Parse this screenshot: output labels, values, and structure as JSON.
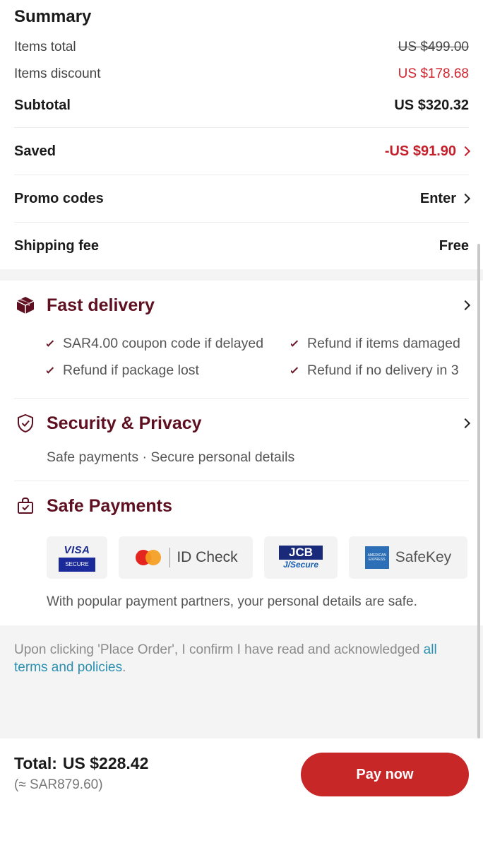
{
  "summary": {
    "title": "Summary",
    "items_total_label": "Items total",
    "items_total_value": "US $499.00",
    "items_discount_label": "Items discount",
    "items_discount_value": "US $178.68",
    "subtotal_label": "Subtotal",
    "subtotal_value": "US $320.32",
    "saved_label": "Saved",
    "saved_value": "-US $91.90",
    "promo_label": "Promo codes",
    "promo_value": "Enter",
    "shipping_label": "Shipping fee",
    "shipping_value": "Free"
  },
  "fast_delivery": {
    "title": "Fast delivery",
    "icon": "package-icon",
    "items": [
      "SAR4.00 coupon code if delayed",
      "Refund if items damaged",
      "Refund if package lost",
      "Refund if no delivery in 3"
    ]
  },
  "security": {
    "title": "Security & Privacy",
    "icon": "shield-check-icon",
    "description": "Safe payments · Secure personal details"
  },
  "safe_payments": {
    "title": "Safe Payments",
    "icon": "bag-check-icon",
    "partners": {
      "visa_top": "VISA",
      "visa_bottom": "SECURE",
      "mastercard": "ID Check",
      "jcb_top": "JCB",
      "jcb_bottom": "J/Secure",
      "amex_badge": "AMERICAN EXPRESS",
      "amex": "SafeKey"
    },
    "note": "With popular payment partners, your personal details are safe."
  },
  "legal": {
    "text": "Upon clicking 'Place Order', I confirm I have read and acknowledged ",
    "link": "all terms and policies",
    "end": "."
  },
  "footer": {
    "total_label": "Total:",
    "total_value": "US $228.42",
    "total_converted": "(≈ SAR879.60)",
    "pay_button": "Pay now"
  },
  "colors": {
    "accent_red": "#c82728",
    "title_maroon": "#5e1021",
    "discount_red": "#d0252f",
    "link_blue": "#2a8fb0"
  }
}
